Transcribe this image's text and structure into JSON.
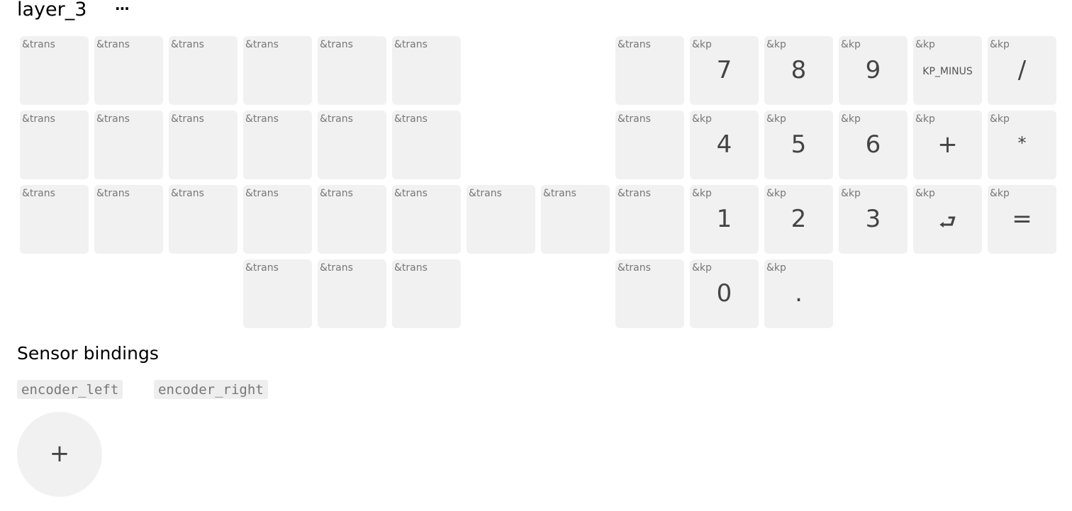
{
  "layer": {
    "title": "layer_3",
    "menu_icon": "ellipsis-icon",
    "menu_label": "···"
  },
  "keymap": {
    "rows": [
      [
        {
          "b": "&trans",
          "p": ""
        },
        {
          "b": "&trans",
          "p": ""
        },
        {
          "b": "&trans",
          "p": ""
        },
        {
          "b": "&trans",
          "p": ""
        },
        {
          "b": "&trans",
          "p": ""
        },
        {
          "b": "&trans",
          "p": ""
        },
        null,
        null,
        {
          "b": "&trans",
          "p": ""
        },
        {
          "b": "&kp",
          "p": "7"
        },
        {
          "b": "&kp",
          "p": "8"
        },
        {
          "b": "&kp",
          "p": "9"
        },
        {
          "b": "&kp",
          "p": "KP_MINUS"
        },
        {
          "b": "&kp",
          "p": "/"
        }
      ],
      [
        {
          "b": "&trans",
          "p": ""
        },
        {
          "b": "&trans",
          "p": ""
        },
        {
          "b": "&trans",
          "p": ""
        },
        {
          "b": "&trans",
          "p": ""
        },
        {
          "b": "&trans",
          "p": ""
        },
        {
          "b": "&trans",
          "p": ""
        },
        null,
        null,
        {
          "b": "&trans",
          "p": ""
        },
        {
          "b": "&kp",
          "p": "4"
        },
        {
          "b": "&kp",
          "p": "5"
        },
        {
          "b": "&kp",
          "p": "6"
        },
        {
          "b": "&kp",
          "p": "+"
        },
        {
          "b": "&kp",
          "p": "*"
        }
      ],
      [
        {
          "b": "&trans",
          "p": ""
        },
        {
          "b": "&trans",
          "p": ""
        },
        {
          "b": "&trans",
          "p": ""
        },
        {
          "b": "&trans",
          "p": ""
        },
        {
          "b": "&trans",
          "p": ""
        },
        {
          "b": "&trans",
          "p": ""
        },
        {
          "b": "&trans",
          "p": ""
        },
        {
          "b": "&trans",
          "p": ""
        },
        {
          "b": "&trans",
          "p": ""
        },
        {
          "b": "&kp",
          "p": "1"
        },
        {
          "b": "&kp",
          "p": "2"
        },
        {
          "b": "&kp",
          "p": "3"
        },
        {
          "b": "&kp",
          "p": "⮐"
        },
        {
          "b": "&kp",
          "p": "="
        }
      ],
      [
        null,
        null,
        null,
        {
          "b": "&trans",
          "p": ""
        },
        {
          "b": "&trans",
          "p": ""
        },
        {
          "b": "&trans",
          "p": ""
        },
        null,
        null,
        {
          "b": "&trans",
          "p": ""
        },
        {
          "b": "&kp",
          "p": "0"
        },
        {
          "b": "&kp",
          "p": "."
        },
        null,
        null,
        null
      ]
    ]
  },
  "sensors": {
    "title": "Sensor bindings",
    "items": [
      "encoder_left",
      "encoder_right"
    ]
  },
  "add_button": {
    "label": "+",
    "icon": "plus-icon"
  }
}
